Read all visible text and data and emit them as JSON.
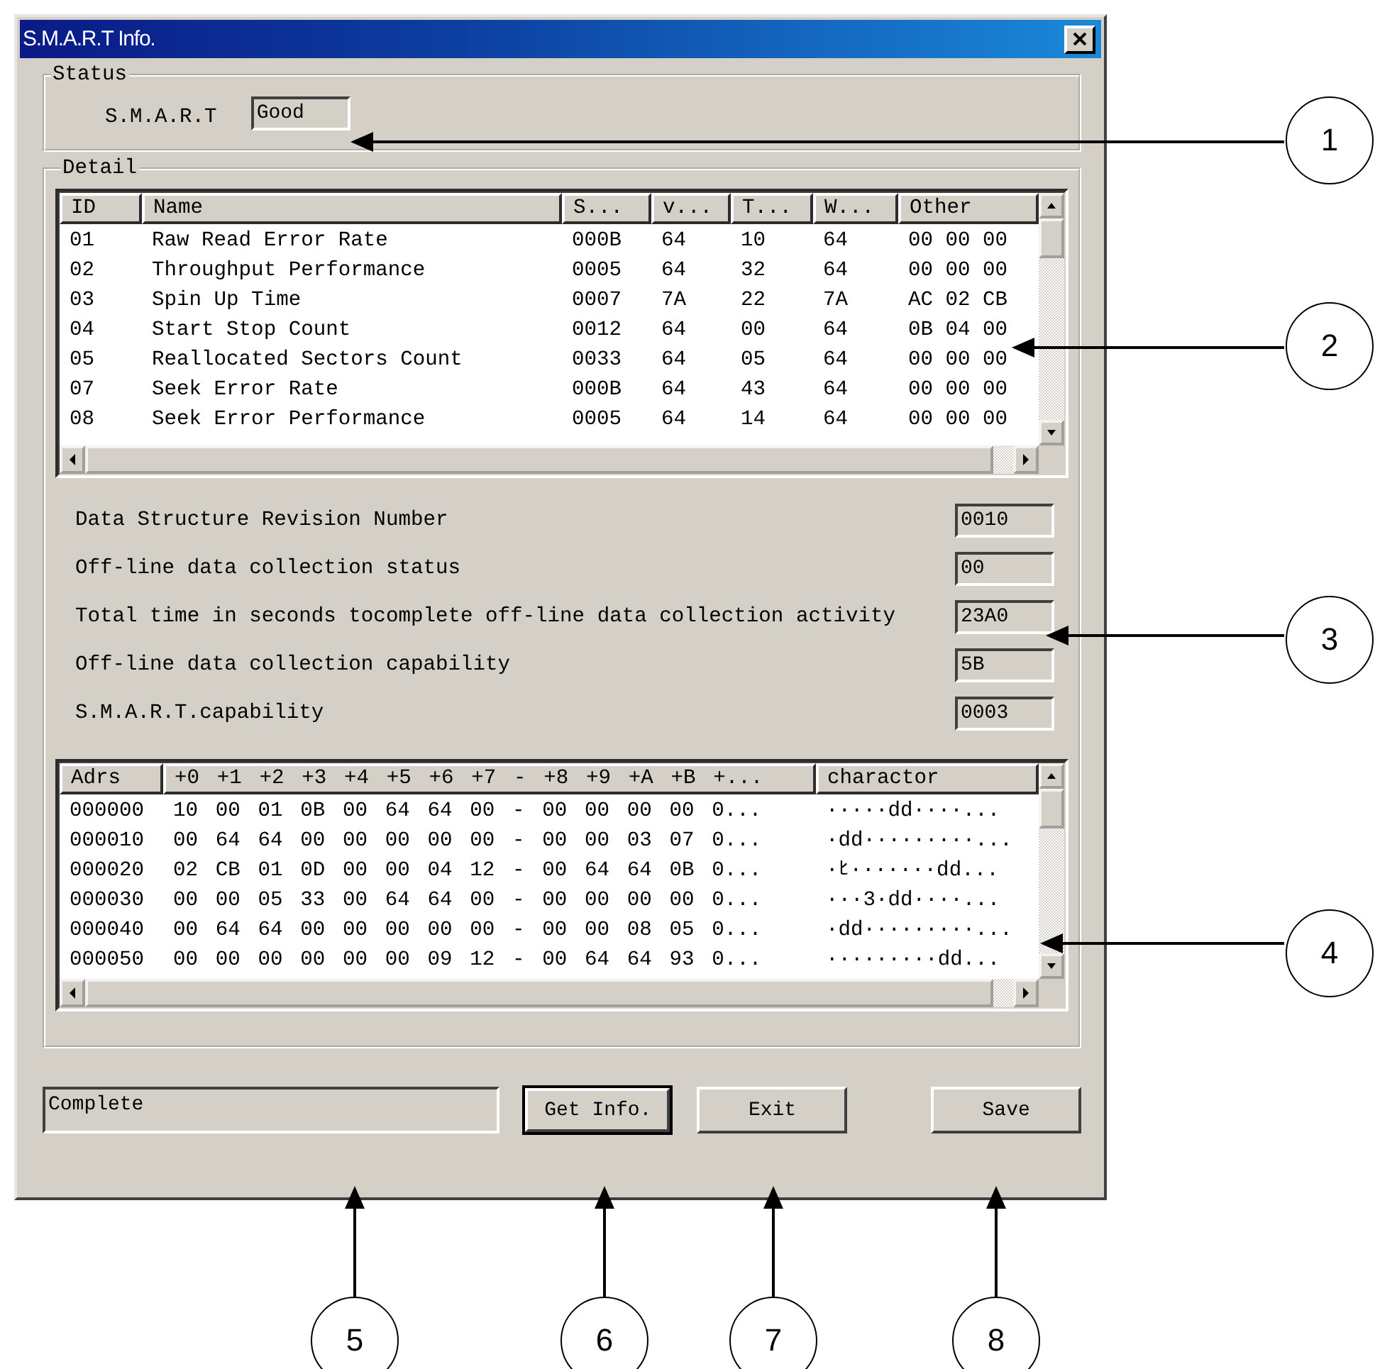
{
  "window": {
    "title": "S.M.A.R.T Info."
  },
  "status_group": {
    "title": "Status",
    "label": "S.M.A.R.T",
    "value": "Good"
  },
  "detail_group": {
    "title": "Detail",
    "attributes_table": {
      "columns": [
        "ID",
        "Name",
        "S...",
        "v...",
        "T...",
        "W...",
        "Other"
      ],
      "rows": [
        [
          "01",
          "Raw Read Error Rate",
          "000B",
          "64",
          "10",
          "64",
          "00 00 00"
        ],
        [
          "02",
          "Throughput Performance",
          "0005",
          "64",
          "32",
          "64",
          "00 00 00"
        ],
        [
          "03",
          "Spin Up Time",
          "0007",
          "7A",
          "22",
          "7A",
          "AC 02 CB"
        ],
        [
          "04",
          "Start Stop Count",
          "0012",
          "64",
          "00",
          "64",
          "0B 04 00"
        ],
        [
          "05",
          "Reallocated Sectors Count",
          "0033",
          "64",
          "05",
          "64",
          "00 00 00"
        ],
        [
          "07",
          "Seek Error Rate",
          "000B",
          "64",
          "43",
          "64",
          "00 00 00"
        ],
        [
          "08",
          "Seek Error Performance",
          "0005",
          "64",
          "14",
          "64",
          "00 00 00"
        ]
      ]
    },
    "fields": [
      {
        "label": "Data Structure Revision Number",
        "value": "0010"
      },
      {
        "label": "Off-line data collection status",
        "value": "00"
      },
      {
        "label": "Total time in seconds tocomplete off-line data collection activity",
        "value": "23A0"
      },
      {
        "label": "Off-line data collection capability",
        "value": "5B"
      },
      {
        "label": "S.M.A.R.T.capability",
        "value": "0003"
      }
    ],
    "dump_table": {
      "columns": [
        "Adrs",
        "+0 +1 +2 +3 +4 +5 +6 +7 - +8 +9 +A +B +...",
        "charactor"
      ],
      "rows": [
        [
          "000000",
          "10 00 01 0B 00 64 64 00 - 00 00 00 00 0...",
          "·····dd····..."
        ],
        [
          "000010",
          "00 64 64 00 00 00 00 00 - 00 00 03 07 0...",
          "·dd·········..."
        ],
        [
          "000020",
          "02 CB 01 0D 00 00 04 12 - 00 64 64 0B 0...",
          "·ﾋ·······dd..."
        ],
        [
          "000030",
          "00 00 05 33 00 64 64 00 - 00 00 00 00 0...",
          "···3·dd····..."
        ],
        [
          "000040",
          "00 64 64 00 00 00 00 00 - 00 00 08 05 0...",
          "·dd·········..."
        ],
        [
          "000050",
          "00 00 00 00 00 00 09 12 - 00 64 64 93 0...",
          "·········dd..."
        ]
      ]
    }
  },
  "status_bar": {
    "value": "Complete"
  },
  "buttons": [
    {
      "label": "Get Info.",
      "default": true
    },
    {
      "label": "Exit",
      "default": false
    },
    {
      "label": "Save",
      "default": false
    }
  ],
  "callouts": [
    {
      "number": "1"
    },
    {
      "number": "2"
    },
    {
      "number": "3"
    },
    {
      "number": "4"
    },
    {
      "number": "5"
    },
    {
      "number": "6"
    },
    {
      "number": "7"
    },
    {
      "number": "8"
    }
  ]
}
